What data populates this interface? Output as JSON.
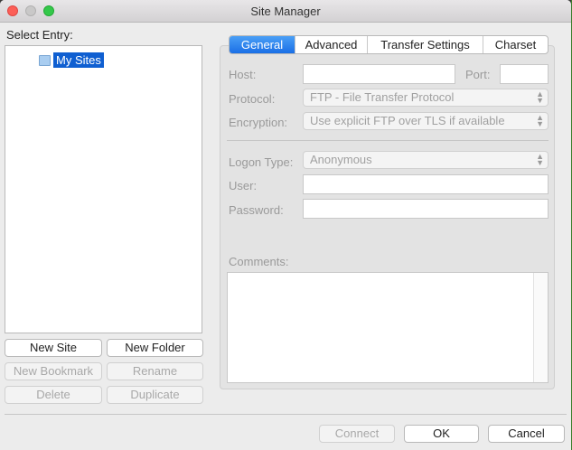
{
  "window": {
    "title": "Site Manager"
  },
  "left": {
    "select_entry_label": "Select Entry:",
    "tree": {
      "root_label": "My Sites"
    },
    "buttons": {
      "new_site": "New Site",
      "new_folder": "New Folder",
      "new_bookmark": "New Bookmark",
      "rename": "Rename",
      "delete": "Delete",
      "duplicate": "Duplicate"
    }
  },
  "tabs": [
    "General",
    "Advanced",
    "Transfer Settings",
    "Charset"
  ],
  "general": {
    "host_label": "Host:",
    "host_value": "",
    "port_label": "Port:",
    "port_value": "",
    "protocol_label": "Protocol:",
    "protocol_value": "FTP - File Transfer Protocol",
    "encryption_label": "Encryption:",
    "encryption_value": "Use explicit FTP over TLS if available",
    "logon_type_label": "Logon Type:",
    "logon_type_value": "Anonymous",
    "user_label": "User:",
    "user_value": "",
    "password_label": "Password:",
    "password_value": "",
    "comments_label": "Comments:",
    "comments_value": ""
  },
  "footer": {
    "connect": "Connect",
    "ok": "OK",
    "cancel": "Cancel"
  },
  "colors": {
    "accent": "#1a6fe6",
    "selection": "#0f5fd1",
    "close": "#fc5f57",
    "zoom": "#34c84a"
  }
}
